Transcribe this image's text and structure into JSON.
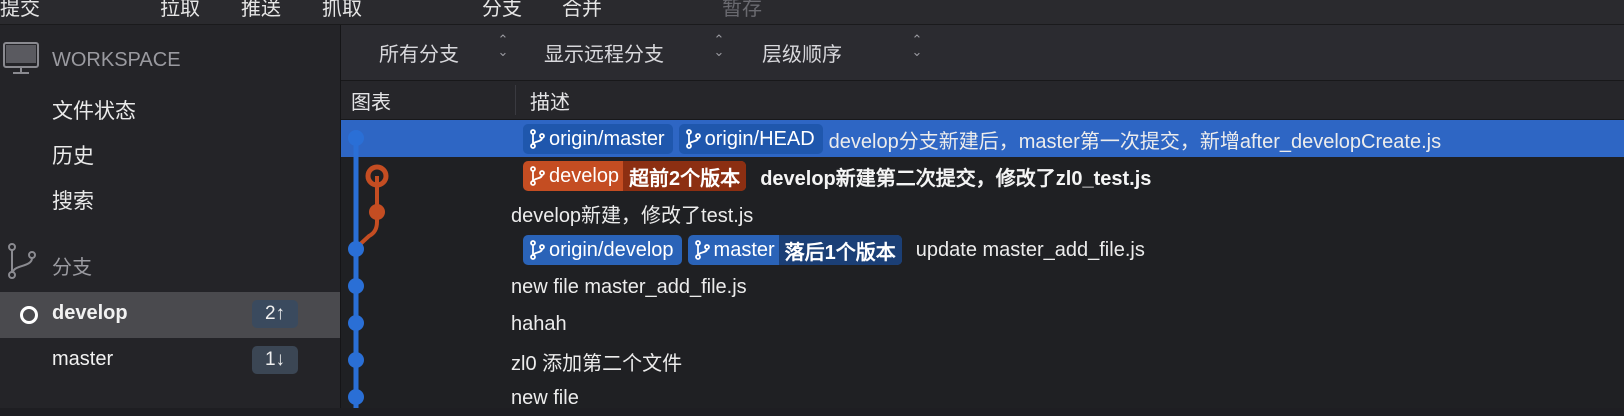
{
  "toolbar": {
    "items": [
      {
        "label": "提交",
        "disabled": false
      },
      {
        "label": "拉取",
        "disabled": false
      },
      {
        "label": "推送",
        "disabled": false
      },
      {
        "label": "抓取",
        "disabled": false
      },
      {
        "label": "分支",
        "disabled": false
      },
      {
        "label": "合并",
        "disabled": false
      },
      {
        "label": "暂存",
        "disabled": true
      }
    ]
  },
  "sidebar": {
    "workspace_title": "WORKSPACE",
    "workspace_items": [
      "文件状态",
      "历史",
      "搜索"
    ],
    "branches_title": "分支",
    "branches": [
      {
        "name": "develop",
        "badge": "2↑",
        "current": true
      },
      {
        "name": "master",
        "badge": "1↓",
        "current": false
      }
    ]
  },
  "filters": {
    "branch_filter": "所有分支",
    "remote_filter": "显示远程分支",
    "order_filter": "层级顺序"
  },
  "columns": {
    "graph": "图表",
    "description": "描述"
  },
  "commits": [
    {
      "tags": [
        {
          "label": "origin/master",
          "color": "blue"
        },
        {
          "label": "origin/HEAD",
          "color": "blue"
        }
      ],
      "message": "develop分支新建后，master第一次提交，新增after_developCreate.js",
      "bold": false
    },
    {
      "tags": [
        {
          "label": "develop",
          "color": "orange",
          "status": "超前2个版本"
        }
      ],
      "message": "develop新建第二次提交，修改了zl0_test.js",
      "bold": true
    },
    {
      "tags": [],
      "message": "develop新建，修改了test.js",
      "bold": false
    },
    {
      "tags": [
        {
          "label": "origin/develop",
          "color": "blue"
        },
        {
          "label": "master",
          "color": "blue",
          "status": "落后1个版本"
        }
      ],
      "message": "update master_add_file.js",
      "bold": false
    },
    {
      "tags": [],
      "message": "new file master_add_file.js",
      "bold": false
    },
    {
      "tags": [],
      "message": "hahah",
      "bold": false
    },
    {
      "tags": [],
      "message": "zl0 添加第二个文件",
      "bold": false
    },
    {
      "tags": [],
      "message": "new file",
      "bold": false
    }
  ],
  "colors": {
    "accent_blue": "#2e66c4",
    "branch_orange": "#c44d22",
    "lane_blue": "#2a6fd6"
  },
  "icons": [
    "monitor-icon",
    "branch-icon",
    "current-branch-icon",
    "chevron-updown-icon"
  ]
}
